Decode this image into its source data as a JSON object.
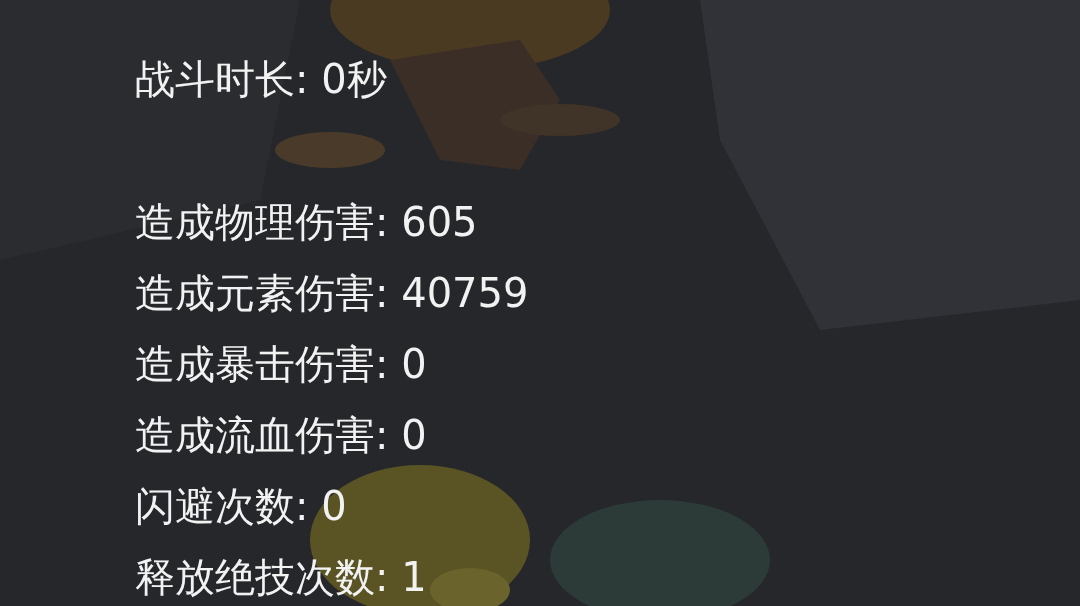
{
  "battle_time": "战斗时长: 0秒",
  "stats": [
    {
      "text": "造成物理伤害: 605"
    },
    {
      "text": "造成元素伤害: 40759"
    },
    {
      "text": "造成暴击伤害: 0"
    },
    {
      "text": "造成流血伤害: 0"
    },
    {
      "text": "闪避次数: 0"
    },
    {
      "text": "释放绝技次数: 1"
    }
  ]
}
